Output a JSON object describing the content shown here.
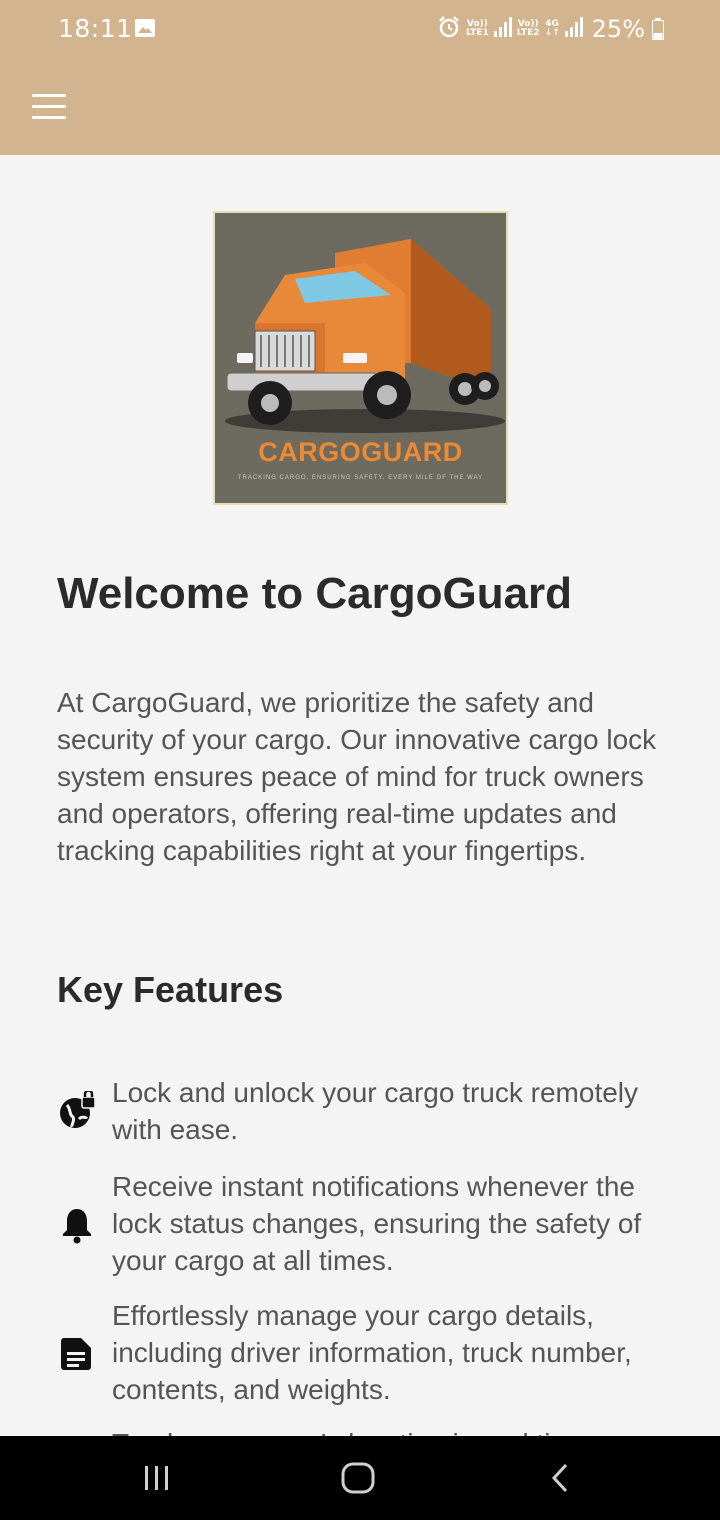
{
  "status_bar": {
    "time": "18:11",
    "sim1_label_top": "Vo))",
    "sim1_label_bottom": "LTE1",
    "sim2_label_top": "Vo))",
    "sim2_label_bottom": "LTE2",
    "network_type": "4G",
    "battery_percent": "25%",
    "icons": [
      "gallery-icon",
      "alarm-icon",
      "signal-icon",
      "battery-icon"
    ]
  },
  "app_bar": {
    "background_color": "#d2b48f",
    "menu_icon": "hamburger-menu-icon"
  },
  "logo": {
    "title": "CARGOGUARD",
    "tagline": "TRACKING CARGO, ENSURING SAFETY, EVERY MILE OF THE WAY",
    "accent_color": "#ee8a2f"
  },
  "main": {
    "welcome_title": "Welcome to CargoGuard",
    "intro": "At CargoGuard, we prioritize the safety and security of your cargo. Our innovative cargo lock system ensures peace of mind for truck owners and operators, offering real-time updates and tracking capabilities right at your fingertips.",
    "features_title": "Key Features",
    "features": [
      {
        "icon": "globe-lock-icon",
        "text": "Lock and unlock your cargo truck remotely with ease."
      },
      {
        "icon": "bell-icon",
        "text": "Receive instant notifications whenever the lock status changes, ensuring the safety of your cargo at all times."
      },
      {
        "icon": "document-icon",
        "text": "Effortlessly manage your cargo details, including driver information, truck number, contents, and weights."
      },
      {
        "icon": "partial-icon",
        "text": "Track your cargo's location in real time"
      }
    ]
  },
  "nav_bar": {
    "buttons": [
      "recents",
      "home",
      "back"
    ]
  }
}
